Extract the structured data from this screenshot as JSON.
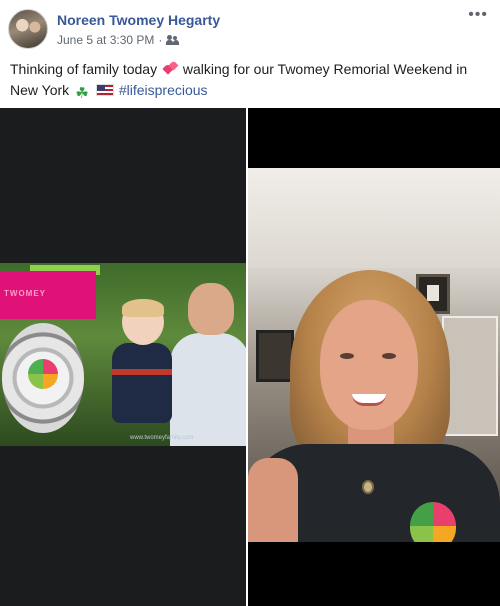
{
  "post": {
    "author": "Noreen Twomey Hegarty",
    "timestamp": "June 5 at 3:30 PM",
    "separator": "·",
    "audience_icon": "friends-icon",
    "more_label": "•••",
    "text": {
      "part1": "Thinking of family today",
      "part2": "walking for our Twomey Remorial Weekend in New York",
      "hashtag": "#lifeisprecious"
    },
    "emojis": [
      "two-hearts",
      "shamrock",
      "us-flag"
    ]
  },
  "photos": {
    "left": {
      "ribbon_text": "TWOMEY",
      "caption_watermark": "www.twomeyfamily.com"
    }
  },
  "colors": {
    "link_blue": "#385898",
    "text": "#1c1e21",
    "meta_gray": "#606770"
  }
}
